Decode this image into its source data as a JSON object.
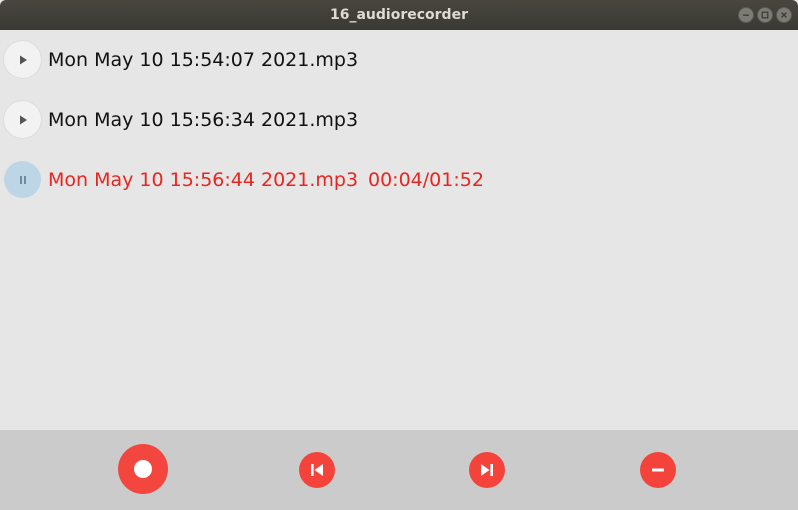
{
  "window": {
    "title": "16_audiorecorder"
  },
  "recordings": [
    {
      "name": "Mon May 10 15:54:07 2021.mp3",
      "state": "stopped",
      "time": ""
    },
    {
      "name": "Mon May 10 15:56:34 2021.mp3",
      "state": "stopped",
      "time": ""
    },
    {
      "name": "Mon May 10 15:56:44 2021.mp3",
      "state": "playing",
      "time": "00:04/01:52"
    }
  ],
  "controls": {
    "record_icon": "record-icon",
    "prev_icon": "skip-previous-icon",
    "next_icon": "skip-next-icon",
    "remove_icon": "minus-icon"
  },
  "colors": {
    "accent": "#f4433a",
    "active_text": "#e8251f",
    "active_button": "#bcd6e6"
  }
}
